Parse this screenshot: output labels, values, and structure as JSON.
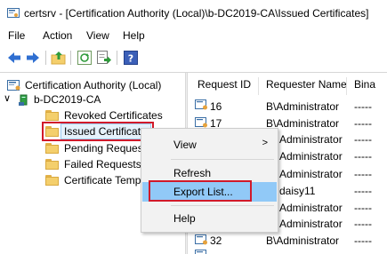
{
  "window": {
    "title": "certsrv - [Certification Authority (Local)\\b-DC2019-CA\\Issued Certificates]"
  },
  "menu": [
    "File",
    "Action",
    "View",
    "Help"
  ],
  "toolbar": {
    "buttons": [
      "back-arrow-icon",
      "forward-arrow-icon",
      "up-folder-icon",
      "refresh-icon",
      "export-list-icon",
      "help-icon"
    ]
  },
  "tree": {
    "root": "Certification Authority (Local)",
    "ca": "b-DC2019-CA",
    "folders": [
      "Revoked Certificates",
      "Issued Certificates",
      "Pending Request",
      "Failed Requests",
      "Certificate Templ"
    ],
    "selected": "Issued Certificates"
  },
  "list": {
    "columns": [
      "Request ID",
      "Requester Name",
      "Bina"
    ],
    "rows": [
      {
        "id": "16",
        "requester": "B\\Administrator",
        "binary": "-----"
      },
      {
        "id": "17",
        "requester": "B\\Administrator",
        "binary": "-----"
      },
      {
        "id": "",
        "requester": "Administrator",
        "binary": "-----"
      },
      {
        "id": "",
        "requester": "Administrator",
        "binary": "-----"
      },
      {
        "id": "",
        "requester": "Administrator",
        "binary": "-----"
      },
      {
        "id": "",
        "requester": "daisy11",
        "binary": "-----"
      },
      {
        "id": "",
        "requester": "Administrator",
        "binary": "-----"
      },
      {
        "id": "",
        "requester": "Administrator",
        "binary": "-----"
      },
      {
        "id": "32",
        "requester": "B\\Administrator",
        "binary": "-----"
      }
    ]
  },
  "context_menu": {
    "items": [
      {
        "label": "View",
        "has_submenu": true,
        "arrow": ">"
      },
      {
        "label": "Refresh"
      },
      {
        "label": "Export List..."
      },
      {
        "label": "Help"
      }
    ],
    "highlighted": "Export List..."
  },
  "colors": {
    "highlight_border": "#d11a2a",
    "menu_hover": "#91c9f7",
    "folder": "#f4cf6c"
  }
}
